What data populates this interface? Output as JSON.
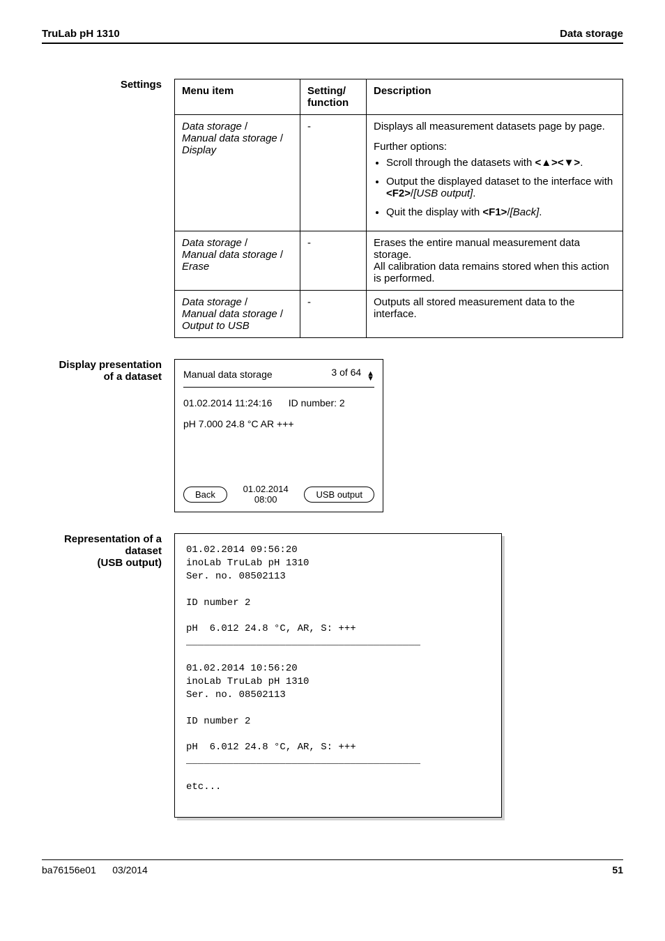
{
  "header": {
    "left": "TruLab pH 1310",
    "right": "Data storage"
  },
  "settings": {
    "label": "Settings",
    "thead": {
      "c1": "Menu item",
      "c2": "Setting/\nfunction",
      "c3": "Description"
    },
    "rows": [
      {
        "menu": {
          "a": "Data storage",
          "b": "Manual data storage",
          "c": "Display"
        },
        "setting": "-",
        "desc_top": "Displays all measurement datasets page by page.",
        "further_label": "Further options:",
        "bullets": [
          {
            "pre": "Scroll through the datasets with ",
            "bold1": "<▲><▼>",
            "post": "."
          },
          {
            "pre": "Output the displayed dataset to the interface with ",
            "bold1": "<F2>",
            "sep": "/",
            "ital": "[USB output]",
            "post": "."
          },
          {
            "pre": "Quit the display with ",
            "bold1": "<F1>",
            "sep": "/",
            "ital": "[Back]",
            "post": "."
          }
        ]
      },
      {
        "menu": {
          "a": "Data storage",
          "b": "Manual data storage",
          "c": "Erase"
        },
        "setting": "-",
        "desc_top": "Erases the entire manual measurement data storage.\nAll calibration data remains stored when this action is performed."
      },
      {
        "menu": {
          "a": "Data storage",
          "b": "Manual data storage",
          "c": "Output to USB"
        },
        "setting": "-",
        "desc_top": "Outputs all stored measurement data to the interface."
      }
    ]
  },
  "disp_presentation": {
    "label_line1": "Display presentation",
    "label_line2": "of a dataset",
    "head_left": "Manual data storage",
    "head_right": "3 of 64",
    "line1_left": "01.02.2014  11:24:16",
    "line1_right": "ID number: 2",
    "line2": "pH 7.000    24.8 °C  AR  +++",
    "back": "Back",
    "stamp_top": "01.02.2014",
    "stamp_bottom": "08:00",
    "usb": "USB output"
  },
  "usb_rep": {
    "label_line1": "Representation of a",
    "label_line2": "dataset",
    "label_line3": "(USB output)",
    "text": "01.02.2014 09:56:20\ninoLab TruLab pH 1310\nSer. no. 08502113\n\nID number 2\n\npH  6.012 24.8 °C, AR, S: +++\n________________________________________\n\n01.02.2014 10:56:20\ninoLab TruLab pH 1310\nSer. no. 08502113\n\nID number 2\n\npH  6.012 24.8 °C, AR, S: +++\n________________________________________\n\netc...\n\n"
  },
  "footer": {
    "left": "ba76156e01",
    "mid": "03/2014",
    "right": "51"
  }
}
